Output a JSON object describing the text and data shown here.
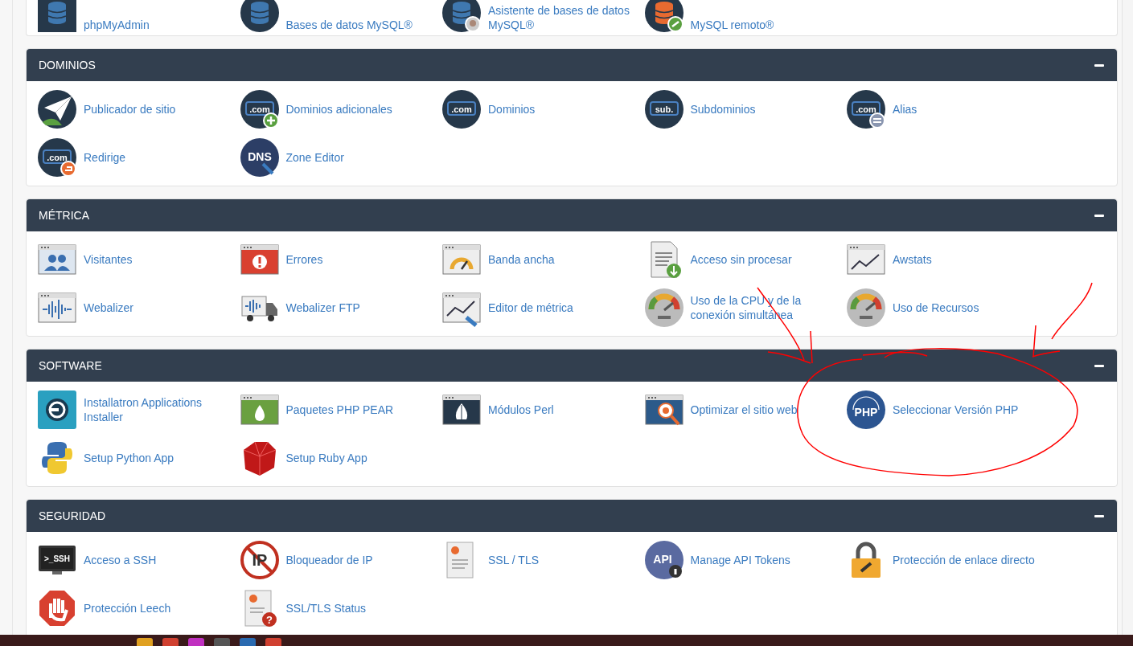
{
  "panels": [
    {
      "items": [
        {
          "label": "phpMyAdmin"
        },
        {
          "label": "Bases de datos MySQL®"
        },
        {
          "label": "Asistente de bases de datos MySQL®"
        },
        {
          "label": "MySQL remoto®"
        }
      ]
    },
    {
      "title": "DOMINIOS",
      "expanded": true,
      "items": [
        {
          "label": "Publicador de sitio"
        },
        {
          "label": "Dominios adicionales",
          "icon_text": ".com"
        },
        {
          "label": "Dominios",
          "icon_text": ".com"
        },
        {
          "label": "Subdominios",
          "icon_text": "sub."
        },
        {
          "label": "Alias",
          "icon_text": ".com"
        },
        {
          "label": "Redirige",
          "icon_text": ".com"
        },
        {
          "label": "Zone Editor",
          "icon_text": "DNS"
        }
      ]
    },
    {
      "title": "MÉTRICA",
      "expanded": true,
      "items": [
        {
          "label": "Visitantes"
        },
        {
          "label": "Errores"
        },
        {
          "label": "Banda ancha"
        },
        {
          "label": "Acceso sin procesar"
        },
        {
          "label": "Awstats"
        },
        {
          "label": "Webalizer"
        },
        {
          "label": "Webalizer FTP"
        },
        {
          "label": "Editor de métrica"
        },
        {
          "label": "Uso de la CPU y de la conexión simultánea"
        },
        {
          "label": "Uso de Recursos"
        }
      ]
    },
    {
      "title": "SOFTWARE",
      "expanded": true,
      "items": [
        {
          "label": "Installatron Applications Installer"
        },
        {
          "label": "Paquetes PHP PEAR"
        },
        {
          "label": "Módulos Perl"
        },
        {
          "label": "Optimizar el sitio web"
        },
        {
          "label": "Seleccionar Versión PHP",
          "icon_text": "PHP"
        },
        {
          "label": "Setup Python App"
        },
        {
          "label": "Setup Ruby App"
        }
      ]
    },
    {
      "title": "SEGURIDAD",
      "expanded": true,
      "items": [
        {
          "label": "Acceso a SSH",
          "icon_text": ">_SSH"
        },
        {
          "label": "Bloqueador de IP",
          "icon_text": "IP"
        },
        {
          "label": "SSL / TLS"
        },
        {
          "label": "Manage API Tokens",
          "icon_text": "API"
        },
        {
          "label": "Protección de enlace directo"
        },
        {
          "label": "Protección Leech"
        },
        {
          "label": "SSL/TLS Status",
          "icon_text": "?"
        }
      ]
    }
  ]
}
